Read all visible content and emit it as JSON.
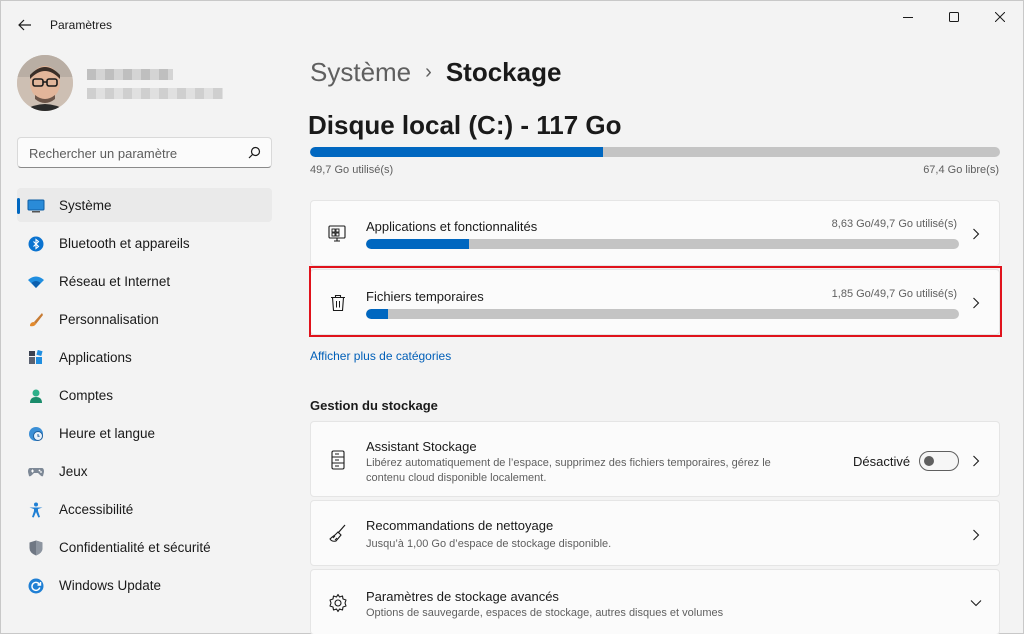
{
  "window": {
    "title": "Paramètres"
  },
  "sidebar": {
    "search_placeholder": "Rechercher un paramètre",
    "items": [
      {
        "label": "Système",
        "icon": "system-icon",
        "active": true
      },
      {
        "label": "Bluetooth et appareils",
        "icon": "bluetooth-icon"
      },
      {
        "label": "Réseau et Internet",
        "icon": "wifi-icon"
      },
      {
        "label": "Personnalisation",
        "icon": "brush-icon"
      },
      {
        "label": "Applications",
        "icon": "apps-icon"
      },
      {
        "label": "Comptes",
        "icon": "account-icon"
      },
      {
        "label": "Heure et langue",
        "icon": "clock-globe-icon"
      },
      {
        "label": "Jeux",
        "icon": "gamepad-icon"
      },
      {
        "label": "Accessibilité",
        "icon": "accessibility-icon"
      },
      {
        "label": "Confidentialité et sécurité",
        "icon": "shield-icon"
      },
      {
        "label": "Windows Update",
        "icon": "update-icon"
      }
    ]
  },
  "breadcrumb": {
    "parent": "Système",
    "separator": "›",
    "current": "Stockage"
  },
  "disk": {
    "title": "Disque local (C:) - 117 Go",
    "used_label": "49,7 Go utilisé(s)",
    "free_label": "67,4 Go libre(s)",
    "used_fraction": 0.425
  },
  "categories": [
    {
      "title": "Applications et fonctionnalités",
      "meta": "8,63 Go/49,7 Go utilisé(s)",
      "fraction": 0.174,
      "icon": "apps-features-icon"
    },
    {
      "title": "Fichiers temporaires",
      "meta": "1,85 Go/49,7 Go utilisé(s)",
      "fraction": 0.037,
      "icon": "trash-icon",
      "highlighted": true
    }
  ],
  "more_categories_link": "Afficher plus de catégories",
  "management": {
    "section_title": "Gestion du stockage",
    "items": [
      {
        "title": "Assistant Stockage",
        "desc_line1": "Libérez automatiquement de l’espace, supprimez des fichiers temporaires, gérez le",
        "desc_line2": "contenu cloud disponible localement.",
        "toggle_label": "Désactivé",
        "toggle_on": false,
        "icon": "storage-sense-icon"
      },
      {
        "title": "Recommandations de nettoyage",
        "desc_line1": "Jusqu’à 1,00 Go d’espace de stockage disponible.",
        "icon": "broom-icon"
      },
      {
        "title": "Paramètres de stockage avancés",
        "desc_line1": "Options de sauvegarde, espaces de stockage, autres disques et volumes",
        "icon": "gear-icon"
      }
    ]
  },
  "colors": {
    "accent": "#0067c0",
    "highlight": "#e0121b",
    "link": "#005fb8"
  }
}
